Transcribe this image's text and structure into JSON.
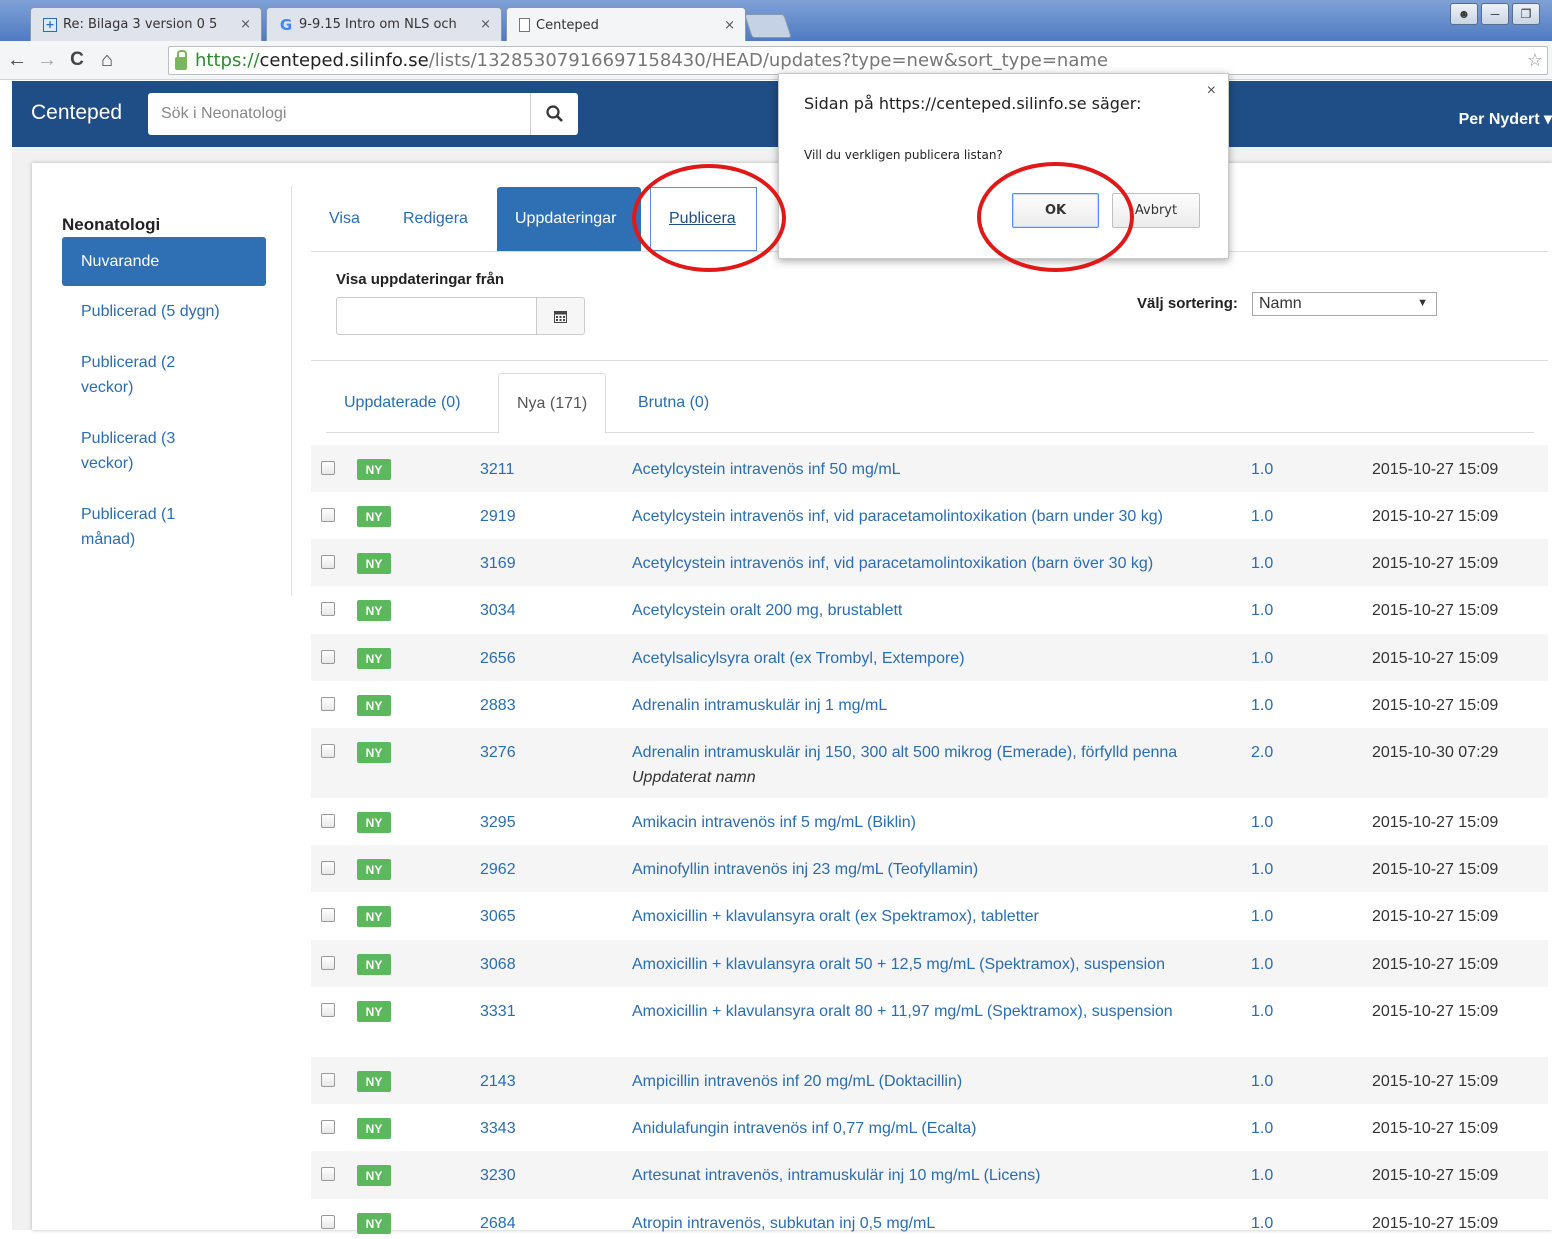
{
  "browser": {
    "tabs": [
      {
        "title": "Re: Bilaga 3 version 0 5",
        "close": "×"
      },
      {
        "title": "9-9.15 Intro om NLS och",
        "close": "×"
      },
      {
        "title": "Centeped",
        "close": "×"
      }
    ],
    "url": {
      "scheme": "https://",
      "host": "centeped.silinfo.se",
      "path": "/lists/13285307916697158430/HEAD/updates?type=new&sort_type=name"
    }
  },
  "header": {
    "brand": "Centeped",
    "search_placeholder": "Sök i Neonatologi",
    "user": "Per Nydert"
  },
  "sidebar": {
    "title": "Neonatologi",
    "items": [
      {
        "label": "Nuvarande"
      },
      {
        "label": "Publicerad (5 dygn)"
      },
      {
        "label": "Publicerad (2 veckor)"
      },
      {
        "label": "Publicerad (3 veckor)"
      },
      {
        "label": "Publicerad (1 månad)"
      }
    ]
  },
  "main_tabs": [
    {
      "label": "Visa"
    },
    {
      "label": "Redigera"
    },
    {
      "label": "Uppdateringar"
    },
    {
      "label": "Publicera"
    }
  ],
  "filter": {
    "label": "Visa uppdateringar från",
    "sort_label": "Välj sortering:",
    "sort_value": "Namn"
  },
  "sub_tabs": [
    {
      "label": "Uppdaterade (0)"
    },
    {
      "label": "Nya (171)"
    },
    {
      "label": "Brutna (0)"
    }
  ],
  "rows": [
    {
      "badge": "NY",
      "id": "3211",
      "name": "Acetylcystein intravenös inf 50 mg/mL",
      "note": "",
      "version": "1.0",
      "date": "2015-10-27 15:09"
    },
    {
      "badge": "NY",
      "id": "2919",
      "name": "Acetylcystein intravenös inf, vid paracetamolintoxikation (barn under 30 kg)",
      "note": "",
      "version": "1.0",
      "date": "2015-10-27 15:09"
    },
    {
      "badge": "NY",
      "id": "3169",
      "name": "Acetylcystein intravenös inf, vid paracetamolintoxikation (barn över 30 kg)",
      "note": "",
      "version": "1.0",
      "date": "2015-10-27 15:09"
    },
    {
      "badge": "NY",
      "id": "3034",
      "name": "Acetylcystein oralt 200 mg, brustablett",
      "note": "",
      "version": "1.0",
      "date": "2015-10-27 15:09"
    },
    {
      "badge": "NY",
      "id": "2656",
      "name": "Acetylsalicylsyra oralt (ex Trombyl, Extempore)",
      "note": "",
      "version": "1.0",
      "date": "2015-10-27 15:09"
    },
    {
      "badge": "NY",
      "id": "2883",
      "name": "Adrenalin intramuskulär inj 1 mg/mL",
      "note": "",
      "version": "1.0",
      "date": "2015-10-27 15:09"
    },
    {
      "badge": "NY",
      "id": "3276",
      "name": "Adrenalin intramuskulär inj 150, 300 alt 500 mikrog (Emerade), förfylld penna",
      "note": "Uppdaterat namn",
      "version": "2.0",
      "date": "2015-10-30 07:29"
    },
    {
      "badge": "NY",
      "id": "3295",
      "name": "Amikacin intravenös inf 5 mg/mL (Biklin)",
      "note": "",
      "version": "1.0",
      "date": "2015-10-27 15:09"
    },
    {
      "badge": "NY",
      "id": "2962",
      "name": "Aminofyllin intravenös inj 23 mg/mL (Teofyllamin)",
      "note": "",
      "version": "1.0",
      "date": "2015-10-27 15:09"
    },
    {
      "badge": "NY",
      "id": "3065",
      "name": "Amoxicillin + klavulansyra oralt (ex Spektramox), tabletter",
      "note": "",
      "version": "1.0",
      "date": "2015-10-27 15:09"
    },
    {
      "badge": "NY",
      "id": "3068",
      "name": "Amoxicillin + klavulansyra oralt 50 + 12,5 mg/mL (Spektramox), suspension",
      "note": "",
      "version": "1.0",
      "date": "2015-10-27 15:09"
    },
    {
      "badge": "NY",
      "id": "3331",
      "name": "Amoxicillin + klavulansyra oralt 80 + 11,97 mg/mL (Spektramox), suspension",
      "note": "",
      "version": "1.0",
      "date": "2015-10-27 15:09"
    },
    {
      "badge": "NY",
      "id": "2143",
      "name": "Ampicillin intravenös inf 20 mg/mL (Doktacillin)",
      "note": "",
      "version": "1.0",
      "date": "2015-10-27 15:09"
    },
    {
      "badge": "NY",
      "id": "3343",
      "name": "Anidulafungin intravenös inf 0,77 mg/mL (Ecalta)",
      "note": "",
      "version": "1.0",
      "date": "2015-10-27 15:09"
    },
    {
      "badge": "NY",
      "id": "3230",
      "name": "Artesunat intravenös, intramuskulär inj 10 mg/mL (Licens)",
      "note": "",
      "version": "1.0",
      "date": "2015-10-27 15:09"
    },
    {
      "badge": "NY",
      "id": "2684",
      "name": "Atropin intravenös, subkutan inj 0,5 mg/mL",
      "note": "",
      "version": "1.0",
      "date": "2015-10-27 15:09"
    }
  ],
  "dialog": {
    "title": "Sidan på https://centeped.silinfo.se säger:",
    "close": "×",
    "message": "Vill du verkligen publicera listan?",
    "ok": "OK",
    "cancel": "Avbryt"
  }
}
